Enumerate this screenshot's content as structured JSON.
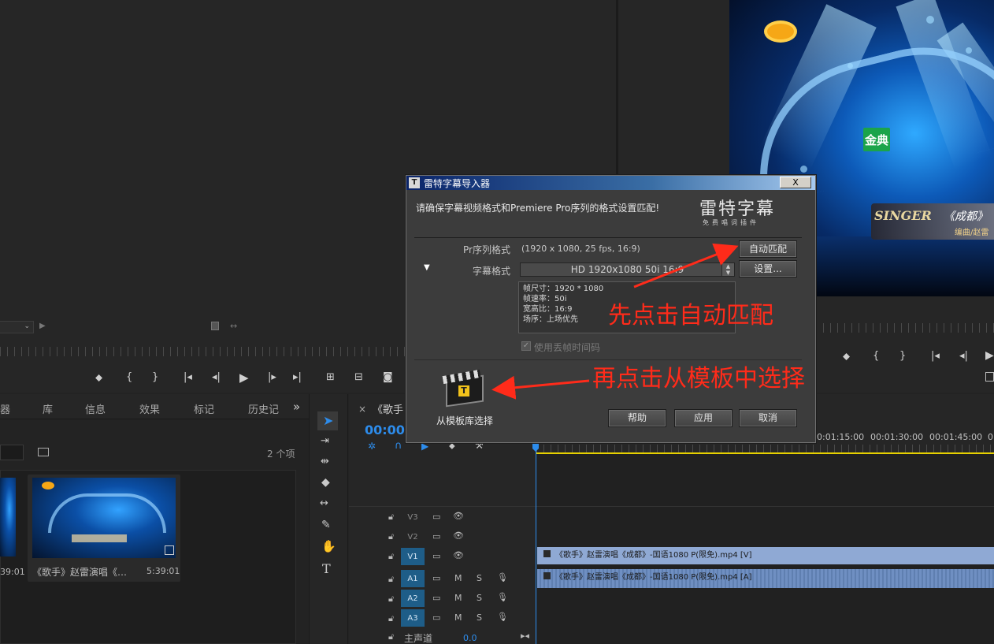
{
  "dialog": {
    "title": "雷特字幕导入器",
    "app_icon": "T",
    "close_label": "X",
    "notice": "请确保字幕视频格式和Premiere Pro序列的格式设置匹配!",
    "logo_main": "雷特字幕",
    "logo_sub": "免费唱词插件",
    "pr_sequence_label": "Pr序列格式",
    "pr_sequence_value": "(1920 x 1080, 25 fps, 16:9)",
    "auto_match_button": "自动匹配",
    "subtitle_format_label": "字幕格式",
    "subtitle_format_value": "HD 1920x1080 50i 16:9",
    "settings_button": "设置...",
    "info_lines": [
      "帧尺寸：1920 * 1080",
      "帧速率：50i",
      "宽高比：16:9",
      "场序：上场优先"
    ],
    "dropframe_label": "使用丢帧时间码",
    "template_lib_label": "从模板库选择",
    "help_button": "帮助",
    "apply_button": "应用",
    "cancel_button": "取消"
  },
  "annotations": {
    "step1": "先点击自动匹配",
    "step2": "再点击从模板中选择"
  },
  "project_panel": {
    "tabs": [
      "器",
      "库",
      "信息",
      "效果",
      "标记",
      "历史记"
    ],
    "more": "»",
    "item_count": "2 个项",
    "clip_name": "《歌手》赵雷演唱《…",
    "clip_duration": "5:39:01",
    "clip_duration_partial": "39:01"
  },
  "timeline": {
    "tab_close": "×",
    "tab_label": "《歌手",
    "timecode_partial": "00:00:0",
    "ruler_times": [
      "0:01:15:00",
      "00:01:30:00",
      "00:01:45:00",
      "0"
    ],
    "tracks": [
      {
        "name": "V3"
      },
      {
        "name": "V2"
      },
      {
        "name": "V1"
      },
      {
        "name": "A1"
      },
      {
        "name": "A2"
      },
      {
        "name": "A3"
      }
    ],
    "video_clip": "《歌手》赵雷演唱《成都》-国语1080 P(限免).mp4 [V]",
    "audio_clip": "《歌手》赵雷演唱《成都》-国语1080 P(限免).mp4 [A]",
    "master_label": "主声道",
    "master_value": "0.0"
  },
  "program_video": {
    "badge": "金典",
    "singer_logo": "SINGER",
    "song_title": "《成都》",
    "credit": "编曲/赵雷"
  },
  "colors": {
    "annotation_red": "#ff2b1a",
    "playhead_blue": "#2d8ceb",
    "work_area_yellow": "#e6d000"
  }
}
